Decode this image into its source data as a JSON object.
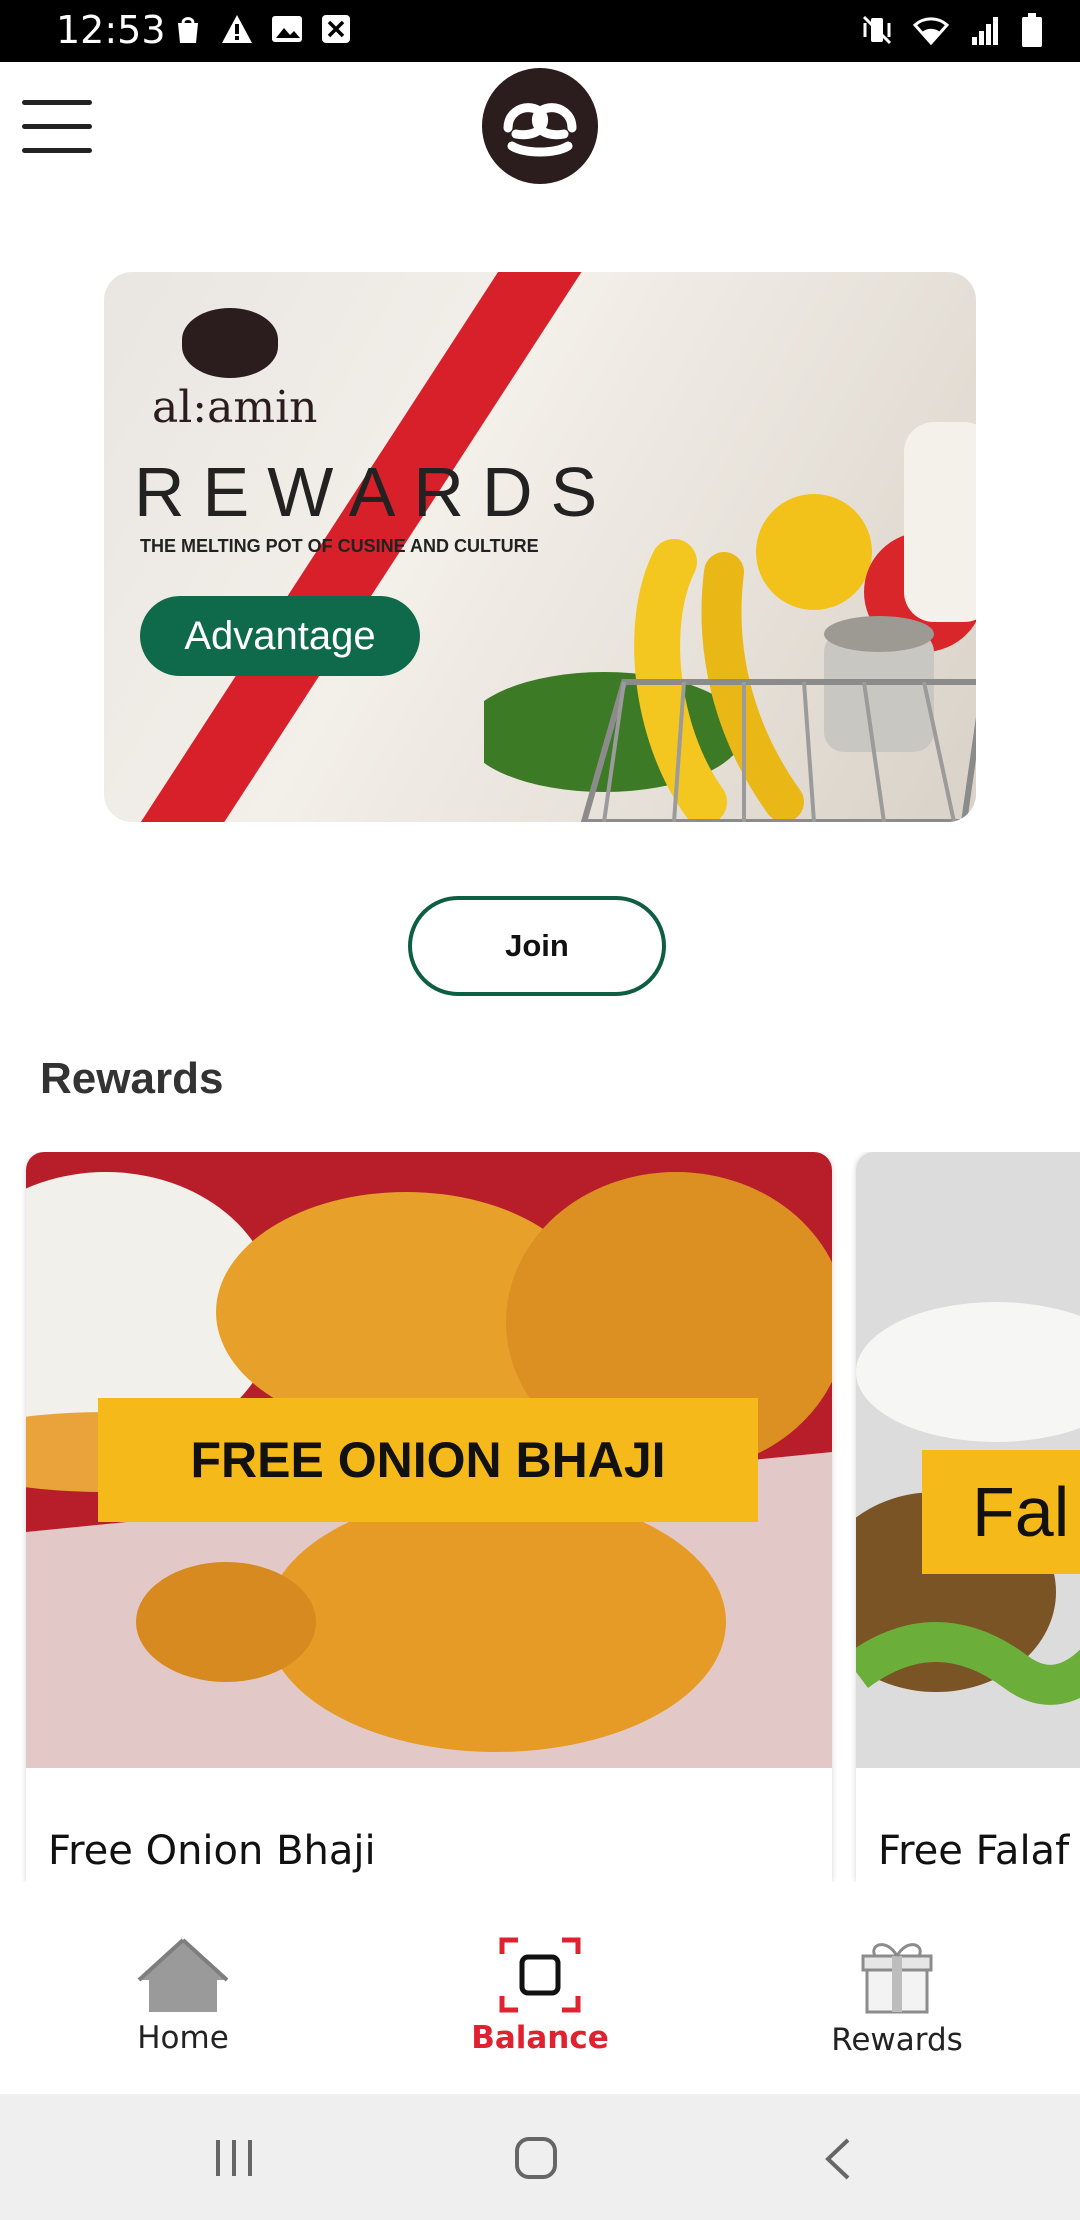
{
  "status_bar": {
    "time": "12:53",
    "left_icons": [
      "shopping-bag-icon",
      "warning-icon",
      "image-icon",
      "close-box-icon"
    ],
    "right_icons": [
      "vibrate-mute-icon",
      "wifi-icon",
      "signal-icon",
      "battery-icon"
    ]
  },
  "app_bar": {
    "menu_icon": "hamburger-menu-icon",
    "logo": "al-amin-logo"
  },
  "banner": {
    "brand": "al:amin",
    "title": "REWARDS",
    "tagline": "THE MELTING POT OF CUSINE AND CULTURE",
    "badge": "Advantage"
  },
  "join_button": "Join",
  "rewards_section": {
    "title": "Rewards",
    "cards": [
      {
        "image_label": "FREE ONION BHAJI",
        "name": "Free Onion Bhaji"
      },
      {
        "image_label": "Fal",
        "name": "Free Falaf"
      }
    ]
  },
  "bottom_nav": {
    "items": [
      {
        "label": "Home",
        "icon": "home-icon",
        "active": false
      },
      {
        "label": "Balance",
        "icon": "scan-frame-icon",
        "active": true
      },
      {
        "label": "Rewards",
        "icon": "gift-icon",
        "active": false
      }
    ],
    "active_color": "#e0212f",
    "inactive_color": "#222222"
  },
  "system_nav": [
    "recents-icon",
    "home-circle-icon",
    "back-icon"
  ],
  "colors": {
    "brand_green": "#0d5e43",
    "brand_red": "#d8202b",
    "reward_label_yellow": "#f6b91a"
  }
}
